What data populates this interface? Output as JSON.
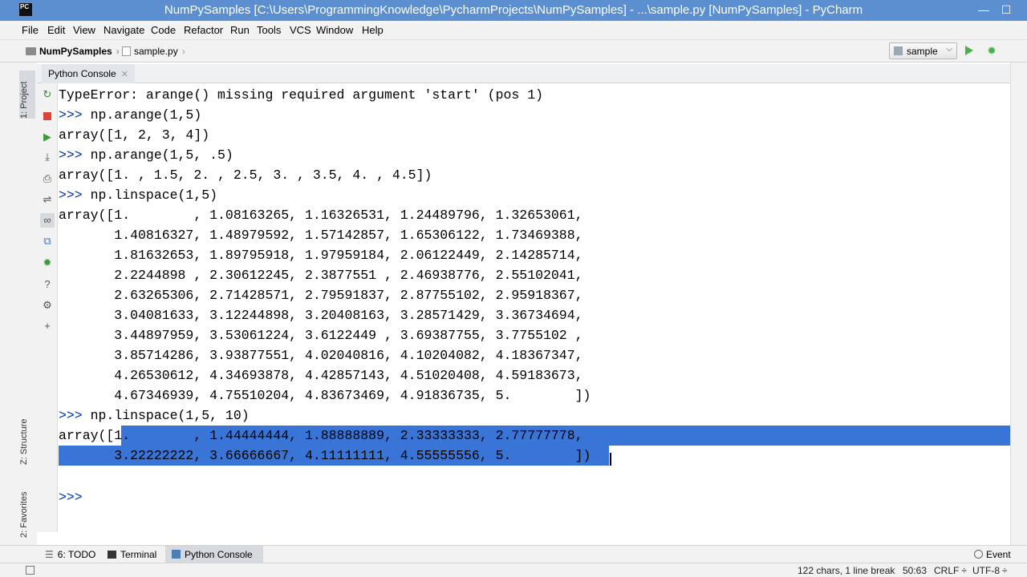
{
  "titlebar": {
    "app_logo": "PC",
    "title": "NumPySamples [C:\\Users\\ProgrammingKnowledge\\PycharmProjects\\NumPySamples] - ...\\sample.py [NumPySamples] - PyCharm",
    "minimize": "—",
    "maximize": "☐"
  },
  "menu": {
    "items": [
      "File",
      "Edit",
      "View",
      "Navigate",
      "Code",
      "Refactor",
      "Run",
      "Tools",
      "VCS",
      "Window",
      "Help"
    ]
  },
  "navbar": {
    "project": "NumPySamples",
    "file": "sample.py",
    "run_config": "sample"
  },
  "left_stripe": {
    "project_tab": "1: Project",
    "structure_tab": "Z: Structure",
    "favorites_tab": "2: Favorites"
  },
  "console": {
    "tab_label": "Python Console",
    "lines": [
      {
        "prompt": "",
        "text": "TypeError: arange() missing required argument 'start' (pos 1)"
      },
      {
        "prompt": ">>> ",
        "text": "np.arange(1,5)"
      },
      {
        "prompt": "",
        "text": "array([1, 2, 3, 4])"
      },
      {
        "prompt": ">>> ",
        "text": "np.arange(1,5, .5)"
      },
      {
        "prompt": "",
        "text": "array([1. , 1.5, 2. , 2.5, 3. , 3.5, 4. , 4.5])"
      },
      {
        "prompt": ">>> ",
        "text": "np.linspace(1,5)"
      },
      {
        "prompt": "",
        "text": "array([1.        , 1.08163265, 1.16326531, 1.24489796, 1.32653061,"
      },
      {
        "prompt": "",
        "text": "       1.40816327, 1.48979592, 1.57142857, 1.65306122, 1.73469388,"
      },
      {
        "prompt": "",
        "text": "       1.81632653, 1.89795918, 1.97959184, 2.06122449, 2.14285714,"
      },
      {
        "prompt": "",
        "text": "       2.2244898 , 2.30612245, 2.3877551 , 2.46938776, 2.55102041,"
      },
      {
        "prompt": "",
        "text": "       2.63265306, 2.71428571, 2.79591837, 2.87755102, 2.95918367,"
      },
      {
        "prompt": "",
        "text": "       3.04081633, 3.12244898, 3.20408163, 3.28571429, 3.36734694,"
      },
      {
        "prompt": "",
        "text": "       3.44897959, 3.53061224, 3.6122449 , 3.69387755, 3.7755102 ,"
      },
      {
        "prompt": "",
        "text": "       3.85714286, 3.93877551, 4.02040816, 4.10204082, 4.18367347,"
      },
      {
        "prompt": "",
        "text": "       4.26530612, 4.34693878, 4.42857143, 4.51020408, 4.59183673,"
      },
      {
        "prompt": "",
        "text": "       4.67346939, 4.75510204, 4.83673469, 4.91836735, 5.        ])"
      },
      {
        "prompt": ">>> ",
        "text": "np.linspace(1,5, 10)"
      },
      {
        "prompt": "",
        "text": "array([1.        , 1.44444444, 1.88888889, 2.33333333, 2.77777778,"
      },
      {
        "prompt": "",
        "text": "       3.22222222, 3.66666667, 4.11111111, 4.55555556, 5.        ])"
      },
      {
        "prompt": "",
        "text": ""
      },
      {
        "prompt": ">>> ",
        "text": ""
      }
    ]
  },
  "bottom_tabs": {
    "todo": "6: TODO",
    "terminal": "Terminal",
    "python_console": "Python Console",
    "event_log": "Event"
  },
  "statusbar": {
    "selection_info": "122 chars, 1 line break",
    "position": "50:63",
    "line_separator": "CRLF",
    "encoding": "UTF-8"
  }
}
